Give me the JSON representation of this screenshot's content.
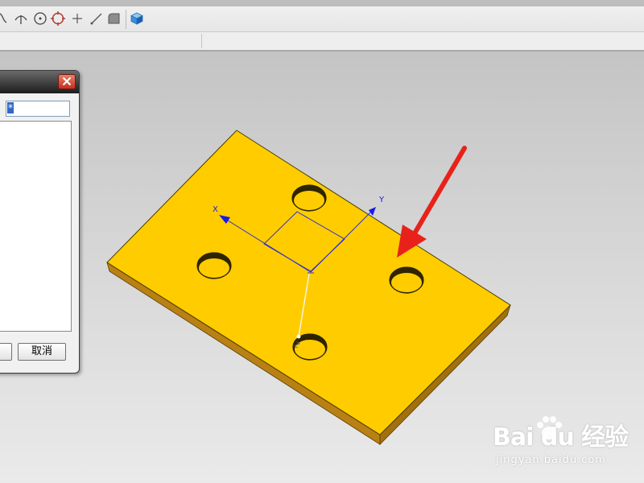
{
  "toolbar": {
    "tools": [
      {
        "name": "curve-tool-icon"
      },
      {
        "name": "arc-tool-icon"
      },
      {
        "name": "circle-center-icon"
      },
      {
        "name": "circle-snap-icon"
      },
      {
        "name": "point-plus-icon"
      },
      {
        "name": "line-tool-icon"
      },
      {
        "name": "fillet-tool-icon"
      },
      {
        "name": "view-cube-icon"
      }
    ]
  },
  "dialog": {
    "input_value": "*",
    "cancel_label": "取消"
  },
  "viewport": {
    "part_color": "#ffcc00",
    "part_side_color": "#b8860b",
    "arrow_color": "#e8221a",
    "axis_color": "#1a1ae6",
    "axes": {
      "x_label": "X",
      "y_label": "Y",
      "z_label": "Z"
    }
  },
  "watermark": {
    "logo_text": "Bai du 经验",
    "url_text": "jingyan.baidu.com"
  }
}
